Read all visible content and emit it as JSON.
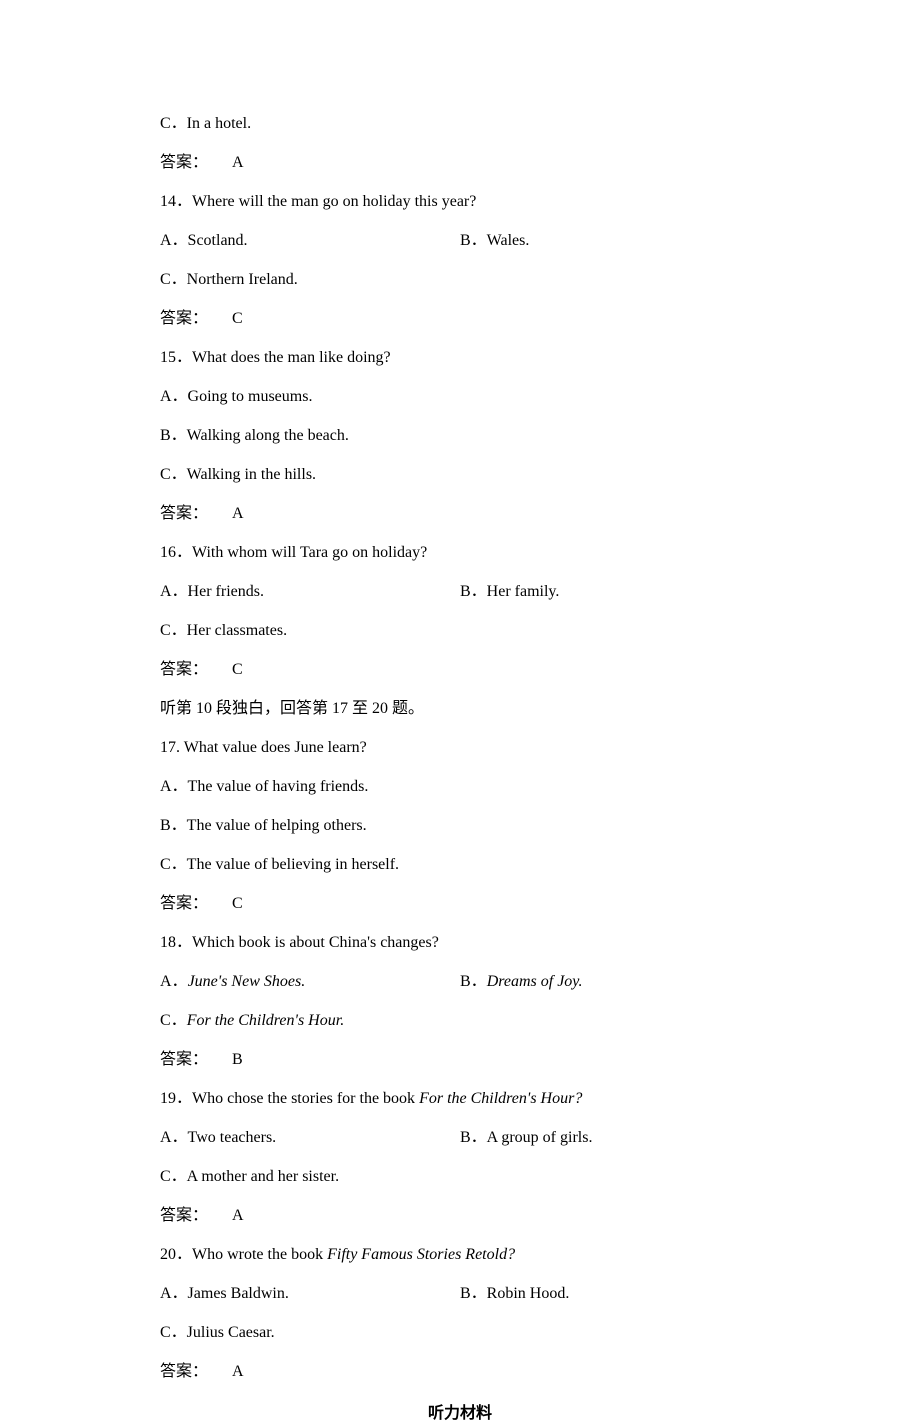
{
  "q13c": "C．In a hotel.",
  "ans13": {
    "label": "答案：",
    "letter": "A"
  },
  "q14": "14．Where will the man go on holiday this year?",
  "q14a": "A．Scotland.",
  "q14b": "B．Wales.",
  "q14c": "C．Northern Ireland.",
  "ans14": {
    "label": "答案：",
    "letter": "C"
  },
  "q15": "15．What does the man like doing?",
  "q15a": "A．Going to museums.",
  "q15b": "B．Walking along the beach.",
  "q15c": "C．Walking in the hills.",
  "ans15": {
    "label": "答案：",
    "letter": "A"
  },
  "q16": "16．With whom will Tara go on holiday?",
  "q16a": "A．Her friends.",
  "q16b": "B．Her family.",
  "q16c": "C．Her classmates.",
  "ans16": {
    "label": "答案：",
    "letter": "C"
  },
  "section": "听第 10 段独白，回答第 17 至 20 题。",
  "q17": "17. What value does June learn?",
  "q17a": "A．The value of having friends.",
  "q17b": "B．The value of helping others.",
  "q17c": "C．The value of believing in herself.",
  "ans17": {
    "label": "答案：",
    "letter": "C"
  },
  "q18": "18．Which book is about China's changes?",
  "q18a_pre": "A．",
  "q18a_it": "June's New Shoes.",
  "q18b_pre": "B．",
  "q18b_it": "Dreams of Joy.",
  "q18c_pre": "C．",
  "q18c_it": "For the Children's Hour.",
  "ans18": {
    "label": "答案：",
    "letter": "B"
  },
  "q19_pre": "19．Who chose the stories for the book ",
  "q19_it": "For the Children's Hour?",
  "q19a": "A．Two teachers.",
  "q19b": "B．A group of girls.",
  "q19c": "C．A mother and her sister.",
  "ans19": {
    "label": "答案：",
    "letter": "A"
  },
  "q20_pre": "20．Who wrote the book ",
  "q20_it": "Fifty Famous Stories Retold?",
  "q20a": "A．James Baldwin.",
  "q20b": "B．Robin Hood.",
  "q20c": "C．Julius Caesar.",
  "ans20": {
    "label": "答案：",
    "letter": "A"
  },
  "footer": "听力材料"
}
